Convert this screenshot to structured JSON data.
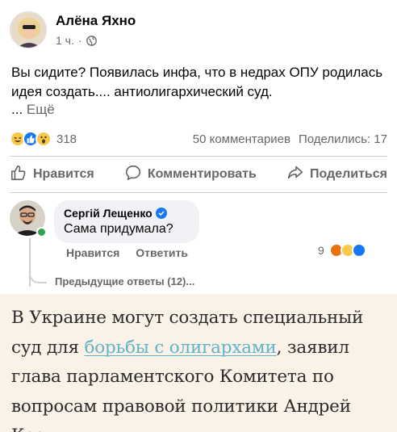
{
  "post": {
    "author_name": "Алёна Яхно",
    "time": "1 ч.",
    "separator": "·",
    "text": "Вы сидите? Появилась инфа, что в недрах ОПУ родилась идея создать.... антиолигархический суд.",
    "ellipsis": "... ",
    "more_label": "Ещё",
    "reaction_count": "318",
    "comments_count": "50 комментариев",
    "shares_count": "Поделились: 17",
    "icons": [
      "globe-icon",
      "haha-reaction-icon",
      "like-reaction-icon",
      "wow-reaction-icon"
    ]
  },
  "actions": {
    "like_label": "Нравится",
    "comment_label": "Комментировать",
    "share_label": "Поделиться"
  },
  "comment": {
    "author_name": "Сергій Лещенко",
    "text": "Сама придумала?",
    "like_label": "Нравится",
    "reply_label": "Ответить",
    "reaction_count": "9",
    "prev_replies": "Предыдущие ответы (12)..."
  },
  "article": {
    "text_before": "В Украине могут создать специальный суд для ",
    "link_text": "борьбы с олигархами",
    "text_after": ", заявил глава парламентского Комитета по вопросам правовой политики Андрей Костин."
  },
  "colors": {
    "accent": "#1877f2",
    "muted": "#65676b",
    "article_bg": "#faf1e7",
    "link": "#5fb3c8"
  }
}
